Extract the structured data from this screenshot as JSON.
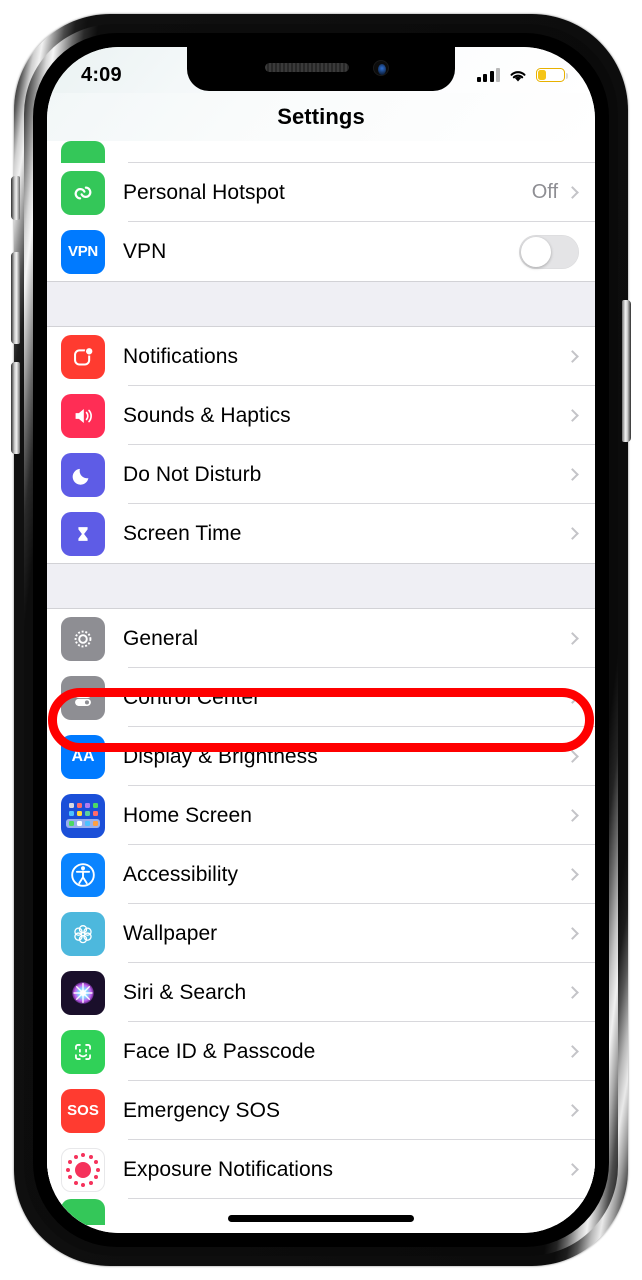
{
  "device": {
    "name": "iphone-x-frame"
  },
  "statusbar": {
    "time": "4:09",
    "signal_bars_filled": 3,
    "signal_bars_total": 4,
    "wifi": "wifi-icon",
    "battery_level_percent": 30,
    "battery_color": "#f5c518"
  },
  "navbar": {
    "title": "Settings"
  },
  "list": {
    "partial_top": {
      "icon": "cellular-icon",
      "label": ""
    },
    "groups": [
      {
        "name": "connectivity",
        "rows": [
          {
            "label": "Personal Hotspot",
            "icon": "personal-hotspot-icon",
            "value": "Off",
            "accessory": "chevron"
          },
          {
            "label": "VPN",
            "icon": "vpn-icon",
            "value": "",
            "accessory": "toggle",
            "toggle_on": false
          }
        ]
      },
      {
        "name": "alerts",
        "rows": [
          {
            "label": "Notifications",
            "icon": "notifications-icon",
            "value": "",
            "accessory": "chevron"
          },
          {
            "label": "Sounds & Haptics",
            "icon": "sounds-haptics-icon",
            "value": "",
            "accessory": "chevron"
          },
          {
            "label": "Do Not Disturb",
            "icon": "do-not-disturb-icon",
            "value": "",
            "accessory": "chevron"
          },
          {
            "label": "Screen Time",
            "icon": "screen-time-icon",
            "value": "",
            "accessory": "chevron"
          }
        ]
      },
      {
        "name": "system",
        "rows": [
          {
            "label": "General",
            "icon": "general-gear-icon",
            "value": "",
            "accessory": "chevron"
          },
          {
            "label": "Control Center",
            "icon": "control-center-icon",
            "value": "",
            "accessory": "chevron",
            "highlighted": true
          },
          {
            "label": "Display & Brightness",
            "icon": "display-brightness-icon",
            "value": "",
            "accessory": "chevron"
          },
          {
            "label": "Home Screen",
            "icon": "home-screen-icon",
            "value": "",
            "accessory": "chevron"
          },
          {
            "label": "Accessibility",
            "icon": "accessibility-icon",
            "value": "",
            "accessory": "chevron"
          },
          {
            "label": "Wallpaper",
            "icon": "wallpaper-icon",
            "value": "",
            "accessory": "chevron"
          },
          {
            "label": "Siri & Search",
            "icon": "siri-search-icon",
            "value": "",
            "accessory": "chevron"
          },
          {
            "label": "Face ID & Passcode",
            "icon": "face-id-icon",
            "value": "",
            "accessory": "chevron"
          },
          {
            "label": "Emergency SOS",
            "icon": "emergency-sos-icon",
            "value": "SOS",
            "accessory": "chevron"
          },
          {
            "label": "Exposure Notifications",
            "icon": "exposure-notifications-icon",
            "value": "",
            "accessory": "chevron"
          }
        ]
      }
    ],
    "partial_bottom": {
      "icon": "green-app-icon",
      "label": ""
    }
  },
  "icon_text": {
    "vpn": "VPN",
    "display": "AA",
    "sos": "SOS"
  },
  "annotation": {
    "shape": "ellipse-outline",
    "color": "#ff0000",
    "targets": "Control Center"
  }
}
